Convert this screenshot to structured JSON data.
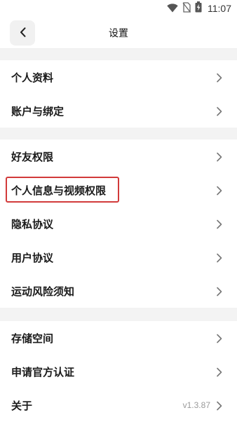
{
  "status_bar": {
    "time": "11:07",
    "icons": [
      "wifi-icon",
      "no-sim-icon",
      "battery-charging-icon"
    ]
  },
  "header": {
    "title": "设置",
    "back_icon": "chevron-left-icon"
  },
  "sections": [
    {
      "items": [
        {
          "label": "个人资料"
        },
        {
          "label": "账户与绑定"
        }
      ]
    },
    {
      "items": [
        {
          "label": "好友权限"
        },
        {
          "label": "个人信息与视频权限",
          "highlighted": true
        },
        {
          "label": "隐私协议"
        },
        {
          "label": "用户协议"
        },
        {
          "label": "运动风险须知"
        }
      ]
    },
    {
      "items": [
        {
          "label": "存储空间"
        },
        {
          "label": "申请官方认证"
        },
        {
          "label": "关于",
          "value": "v1.3.87"
        }
      ]
    }
  ],
  "colors": {
    "highlight": "#d23a3a",
    "section_gap": "#f3f3f3"
  }
}
